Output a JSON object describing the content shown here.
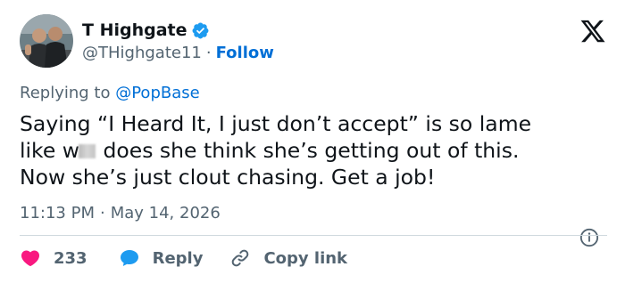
{
  "author": {
    "name": "T Highgate",
    "handle": "@THighgate11",
    "follow_label": "Follow",
    "separator": "·"
  },
  "reply_context": {
    "prefix": "Replying to",
    "mention": "@PopBase"
  },
  "tweet": {
    "line1": "Saying “I Heard It, I just don’t accept” is so lame",
    "line2_start": "like w",
    "line2_end": " does she think she’s getting out of this.",
    "line3": "Now she’s just clout chasing. Get a job!"
  },
  "meta": {
    "time": "11:13 PM",
    "separator": "·",
    "date": "May 14, 2026"
  },
  "actions": {
    "likes_count": "233",
    "reply_label": "Reply",
    "copy_label": "Copy link"
  },
  "colors": {
    "accent": "#1d9bf0",
    "link": "#006fd6",
    "like": "#f91880",
    "muted": "#536471"
  },
  "icons": [
    "verified-badge-icon",
    "x-logo-icon",
    "info-icon",
    "heart-icon",
    "reply-bubble-icon",
    "link-icon"
  ]
}
